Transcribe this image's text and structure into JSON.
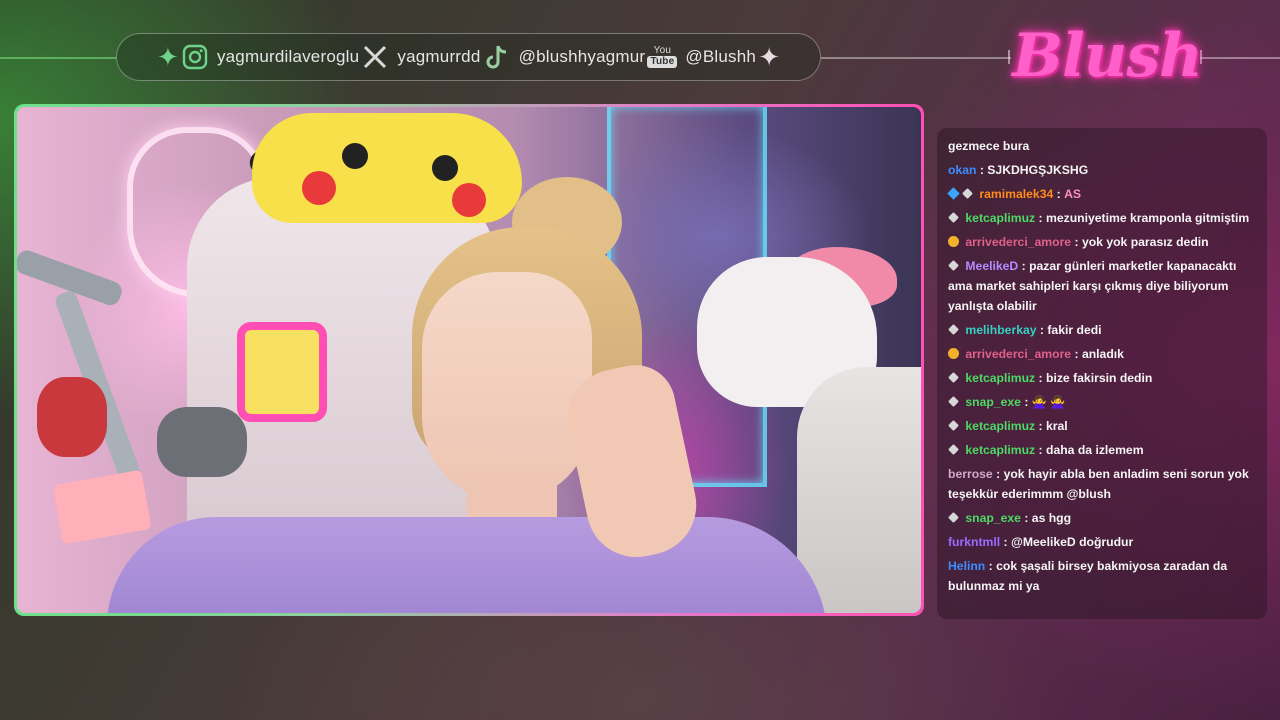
{
  "overlay": {
    "logo_text": "Blush",
    "social": [
      {
        "icon": "instagram-icon",
        "handle": "yagmurdilaveroglu"
      },
      {
        "icon": "x-icon",
        "handle": "yagmurrdd"
      },
      {
        "icon": "tiktok-icon",
        "handle": "@blushhyagmur"
      },
      {
        "icon": "youtube-icon",
        "handle": "@Blushh",
        "icon_top": "You",
        "icon_bottom": "Tube"
      }
    ],
    "sparkle_left": "✦",
    "sparkle_right": "✦",
    "colors": {
      "frame_green": "#6fe08a",
      "frame_pink": "#ff4fb4",
      "logo_pink": "#ff5fc8"
    }
  },
  "chat": {
    "messages": [
      {
        "badges": [],
        "user": "",
        "text": "gezmece bura",
        "color": "#f2f2f2"
      },
      {
        "badges": [],
        "user": "okan",
        "text": "SJKDHGŞJKSHG",
        "color": "#3d8cff"
      },
      {
        "badges": [
          "gem",
          "sub"
        ],
        "user": "ramimalek34",
        "text": "",
        "emote": "AS",
        "color": "#ff8c1a"
      },
      {
        "badges": [
          "sub"
        ],
        "user": "ketcaplimuz",
        "text": "mezuniyetime kramponla gitmiştim",
        "color": "#4cd964"
      },
      {
        "badges": [
          "bits"
        ],
        "user": "arrivederci_amore",
        "text": "yok yok parasız dedin",
        "color": "#e0608a"
      },
      {
        "badges": [
          "sub"
        ],
        "user": "MeelikeD",
        "text": "pazar günleri marketler kapanacaktı ama market sahipleri karşı çıkmış diye biliyorum yanlışta olabilir",
        "color": "#b48cff"
      },
      {
        "badges": [
          "sub"
        ],
        "user": "melihberkay",
        "text": "fakir dedi",
        "color": "#35d0c0"
      },
      {
        "badges": [
          "bits"
        ],
        "user": "arrivederci_amore",
        "text": "anladık",
        "color": "#e0608a"
      },
      {
        "badges": [
          "sub"
        ],
        "user": "ketcaplimuz",
        "text": "bize fakirsin dedin",
        "color": "#4cd964"
      },
      {
        "badges": [
          "sub"
        ],
        "user": "snap_exe",
        "text": "",
        "emote": "🙅‍♀️ 🙅‍♀️",
        "color": "#4cd964"
      },
      {
        "badges": [
          "sub"
        ],
        "user": "ketcaplimuz",
        "text": "kral",
        "color": "#4cd964"
      },
      {
        "badges": [
          "sub"
        ],
        "user": "ketcaplimuz",
        "text": "daha da izlemem",
        "color": "#4cd964"
      },
      {
        "badges": [],
        "user": "berrose",
        "text": "yok hayir abla ben anladim seni sorun yok teşekkür ederimmm @blush",
        "color": "#d0a8c8"
      },
      {
        "badges": [
          "sub"
        ],
        "user": "snap_exe",
        "text": "as hgg",
        "color": "#4cd964"
      },
      {
        "badges": [],
        "user": "furkntmll",
        "text": "@MeelikeD doğrudur",
        "color": "#9b6cff"
      },
      {
        "badges": [],
        "user": "Helinn",
        "text": "cok şaşali birsey bakmiyosa zaradan da bulunmaz mi ya",
        "color": "#3d8cff"
      }
    ]
  }
}
